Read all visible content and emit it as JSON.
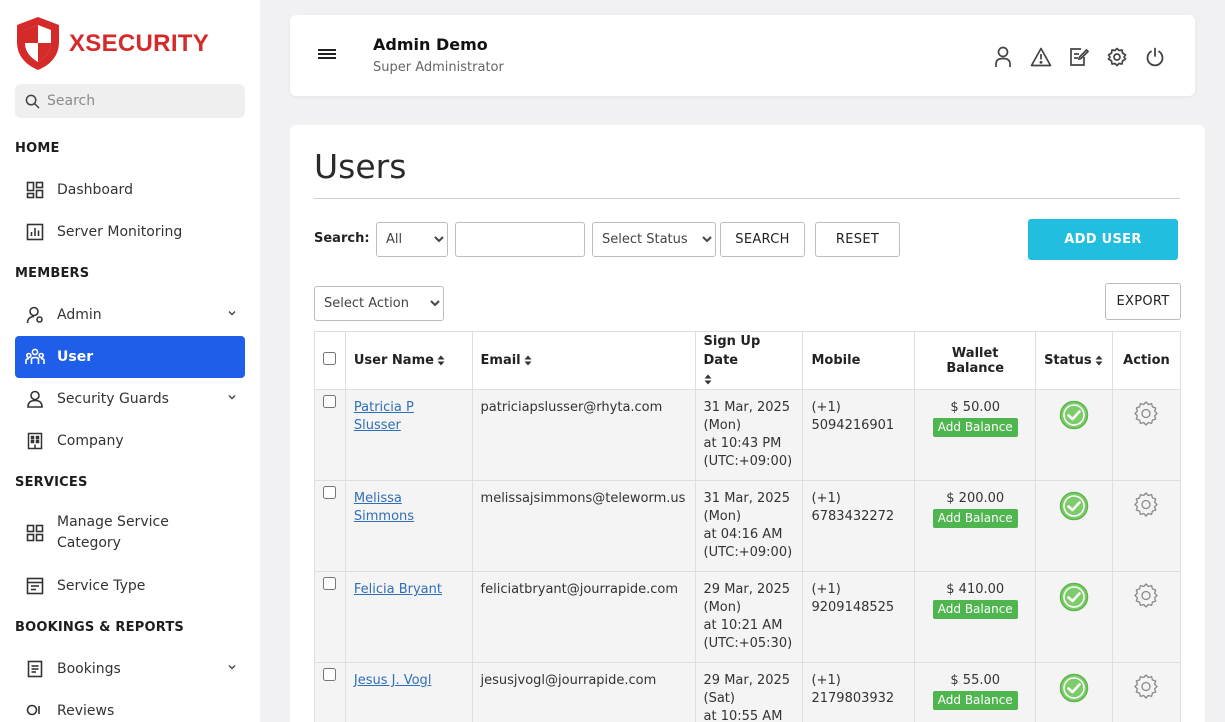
{
  "brand": {
    "name": "XSECURITY",
    "color": "#d42a2a"
  },
  "sidebar": {
    "search_placeholder": "Search",
    "sections": {
      "home": "HOME",
      "members": "MEMBERS",
      "services": "SERVICES",
      "bookings": "BOOKINGS & REPORTS"
    },
    "items": {
      "dashboard": "Dashboard",
      "server_monitoring": "Server Monitoring",
      "admin": "Admin",
      "user": "User",
      "security_guards": "Security Guards",
      "company": "Company",
      "manage_service_category_1": "Manage Service",
      "manage_service_category_2": "Category",
      "service_type": "Service Type",
      "bookings": "Bookings",
      "reviews": "Reviews"
    },
    "active_color": "#1f5ee8"
  },
  "header": {
    "admin_name": "Admin Demo",
    "admin_role": "Super Administrator",
    "icons": [
      "user-icon",
      "warning-icon",
      "edit-icon",
      "settings-icon",
      "power-icon"
    ]
  },
  "main": {
    "title": "Users",
    "search_label": "Search:",
    "filter_field": {
      "selected": "All"
    },
    "search_input": {
      "value": ""
    },
    "status_select": {
      "selected": "Select Status"
    },
    "search_button": "SEARCH",
    "reset_button": "RESET",
    "add_user_button": "ADD USER",
    "action_select": {
      "selected": "Select Action"
    },
    "export_button": "EXPORT",
    "accent": "#22bedf"
  },
  "table": {
    "headers": {
      "user_name": "User Name",
      "email": "Email",
      "signup_date_1": "Sign Up Date",
      "mobile": "Mobile",
      "wallet_balance": "Wallet Balance",
      "status": "Status",
      "action": "Action"
    },
    "add_balance_label": "Add Balance",
    "rows": [
      {
        "name_1": "Patricia P Slusser",
        "name_2": "",
        "email": "patriciapslusser@rhyta.com",
        "date": "31 Mar, 2025",
        "day": "(Mon)",
        "time": "at 10:43 PM",
        "tz": "(UTC:+09:00)",
        "mobile_code": "(+1)",
        "mobile": "5094216901",
        "balance": "$ 50.00"
      },
      {
        "name_1": "Melissa",
        "name_2": "Simmons",
        "email": "melissajsimmons@teleworm.us",
        "date": "31 Mar, 2025",
        "day": "(Mon)",
        "time": "at 04:16 AM",
        "tz": "(UTC:+09:00)",
        "mobile_code": "(+1)",
        "mobile": "6783432272",
        "balance": "$ 200.00"
      },
      {
        "name_1": "Felicia Bryant",
        "name_2": "",
        "email": "feliciatbryant@jourrapide.com",
        "date": "29 Mar, 2025",
        "day": "(Mon)",
        "time": "at 10:21 AM",
        "tz": "(UTC:+05:30)",
        "mobile_code": "(+1)",
        "mobile": "9209148525",
        "balance": "$ 410.00"
      },
      {
        "name_1": "Jesus J. Vogl",
        "name_2": "",
        "email": "jesusjvogl@jourrapide.com",
        "date": "29 Mar, 2025",
        "day": "(Sat)",
        "time": "at 10:55 AM",
        "tz": "",
        "mobile_code": "(+1)",
        "mobile": "2179803932",
        "balance": "$ 55.00"
      }
    ]
  }
}
